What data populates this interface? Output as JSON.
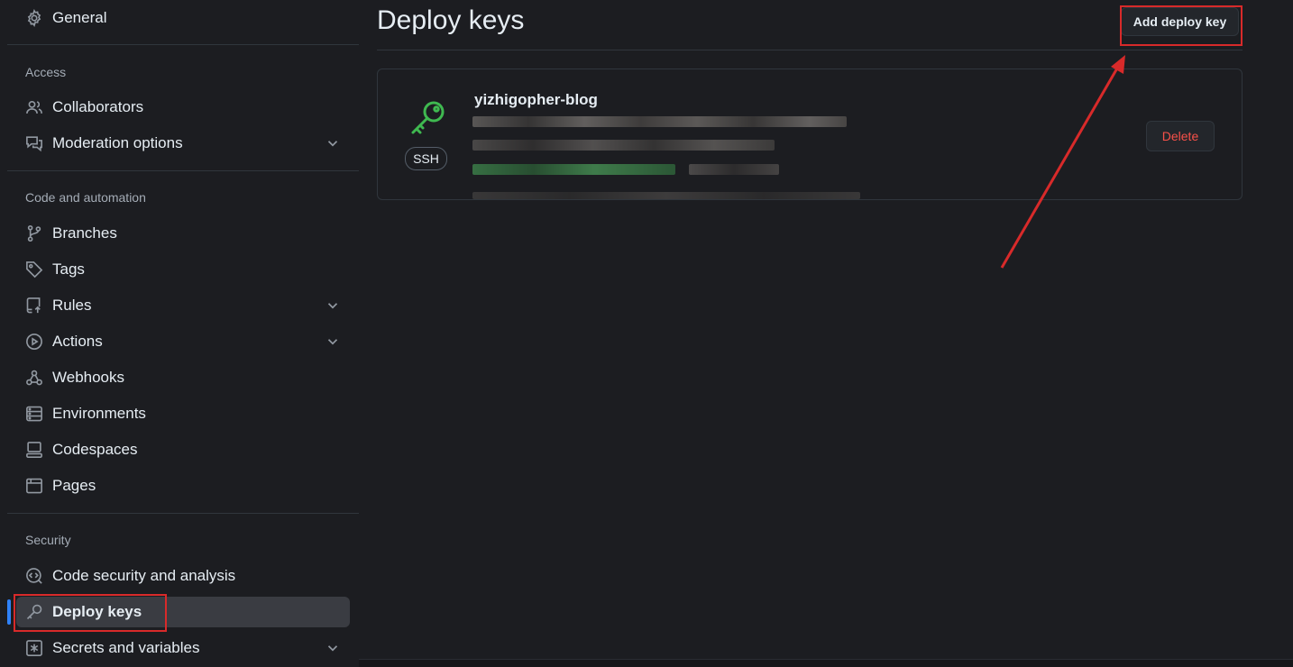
{
  "sidebar": {
    "general": "General",
    "sections": {
      "access": "Access",
      "code_automation": "Code and automation",
      "security": "Security"
    },
    "items": {
      "collaborators": "Collaborators",
      "moderation": "Moderation options",
      "branches": "Branches",
      "tags": "Tags",
      "rules": "Rules",
      "actions": "Actions",
      "webhooks": "Webhooks",
      "environments": "Environments",
      "codespaces": "Codespaces",
      "pages": "Pages",
      "code_security": "Code security and analysis",
      "deploy_keys": "Deploy keys",
      "secrets": "Secrets and variables"
    },
    "active_item": "deploy_keys"
  },
  "main": {
    "title": "Deploy keys",
    "add_button_label": "Add deploy key",
    "keys": [
      {
        "name": "yizhigopher-blog",
        "type_badge": "SSH",
        "delete_label": "Delete",
        "key_icon_color": "#3fb950"
      }
    ]
  },
  "colors": {
    "background": "#1c1d21",
    "danger": "#f85149",
    "accent": "#2f81f7",
    "annotation": "#d82a2a"
  }
}
